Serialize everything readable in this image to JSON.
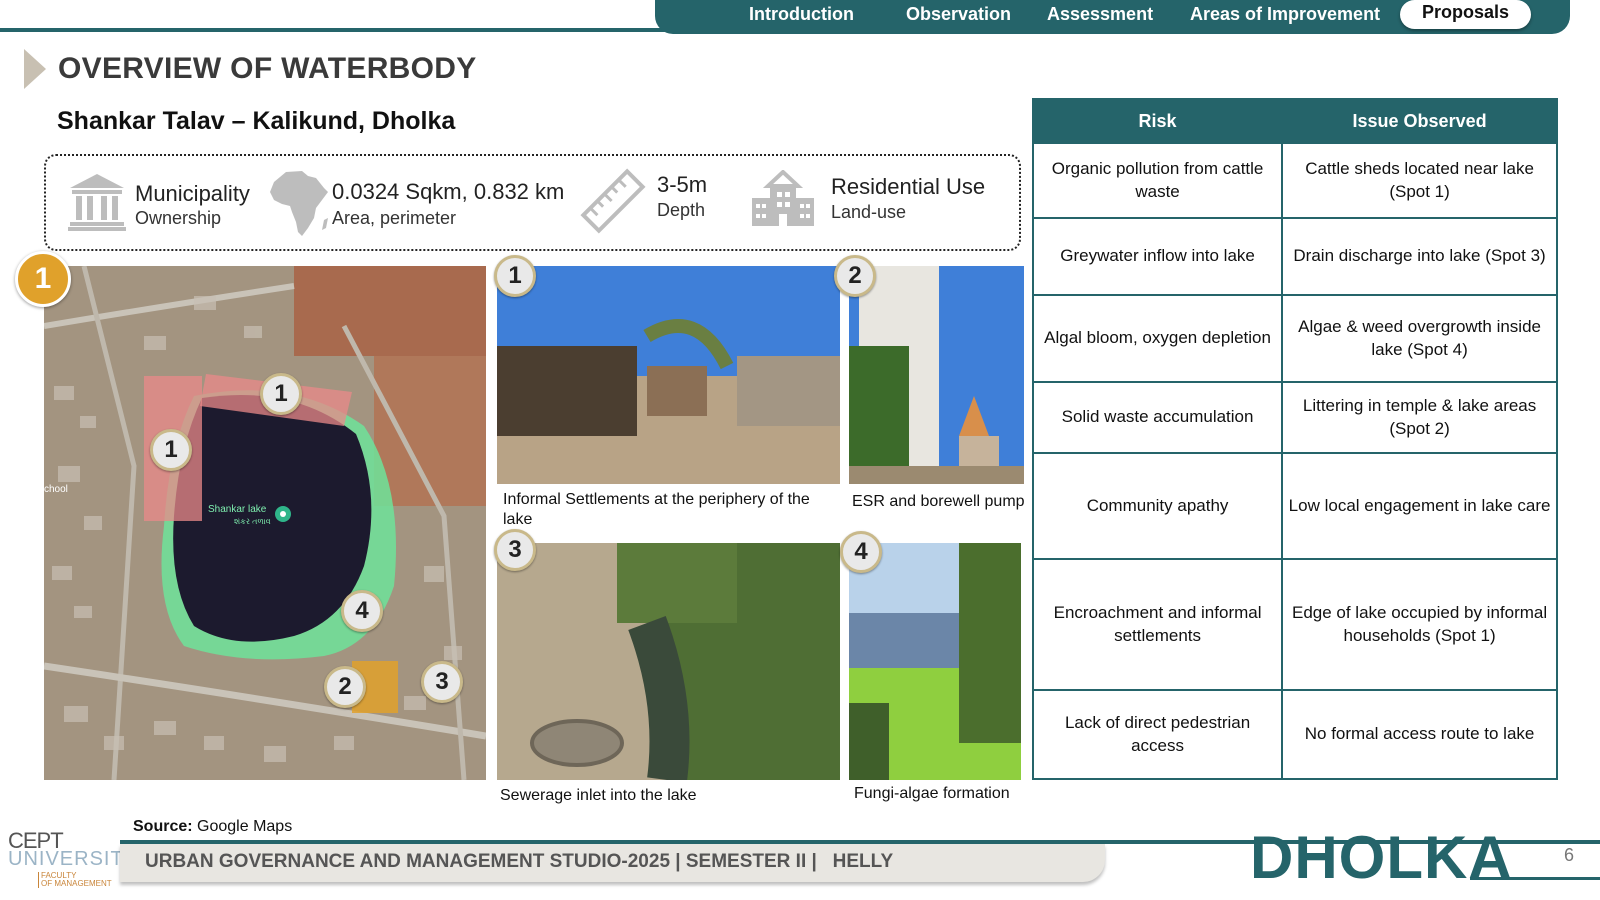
{
  "nav": {
    "items": [
      {
        "label": "Introduction"
      },
      {
        "label": "Observation"
      },
      {
        "label": "Assessment"
      },
      {
        "label": "Areas of Improvement"
      },
      {
        "label": "Proposals"
      }
    ],
    "active": "Proposals"
  },
  "header": {
    "title": "OVERVIEW OF WATERBODY",
    "subtitle": "Shankar Talav – Kalikund, Dholka"
  },
  "stats": [
    {
      "icon": "government-building-icon",
      "value": "Municipality",
      "label": "Ownership"
    },
    {
      "icon": "map-shape-icon",
      "value": "0.0324 Sqkm, 0.832 km",
      "label": "Area, perimeter"
    },
    {
      "icon": "ruler-icon",
      "value": "3-5m",
      "label": "Depth"
    },
    {
      "icon": "residential-buildings-icon",
      "value": "Residential Use",
      "label": "Land-use"
    }
  ],
  "map": {
    "badge": "1",
    "lake_label": "Shankar lake",
    "lake_label_local": "શંકર તળાવ",
    "edge_label": "chool",
    "pins": [
      "1",
      "1",
      "4",
      "2",
      "3"
    ]
  },
  "photos": [
    {
      "number": "1",
      "caption": "Informal Settlements at the periphery of the lake"
    },
    {
      "number": "2",
      "caption": "ESR and borewell pump"
    },
    {
      "number": "3",
      "caption": "Sewerage inlet into the lake"
    },
    {
      "number": "4",
      "caption": "Fungi-algae formation"
    }
  ],
  "table": {
    "headers": [
      "Risk",
      "Issue Observed"
    ],
    "rows": [
      [
        "Organic pollution from cattle waste",
        "Cattle sheds located near lake (Spot 1)"
      ],
      [
        "Greywater inflow into lake",
        "Drain discharge into lake (Spot 3)"
      ],
      [
        "Algal bloom, oxygen depletion",
        "Algae & weed overgrowth inside lake (Spot 4)"
      ],
      [
        "Solid waste accumulation",
        "Littering in temple & lake areas (Spot 2)"
      ],
      [
        "Community apathy",
        "Low local engagement in lake care"
      ],
      [
        "Encroachment and informal settlements",
        "Edge of lake occupied by informal households (Spot 1)"
      ],
      [
        "Lack of direct pedestrian access",
        "No formal access route to lake"
      ]
    ]
  },
  "footer": {
    "source_label": "Source:",
    "source_value": "Google Maps",
    "studio": "URBAN GOVERNANCE AND MANAGEMENT STUDIO-2025 | SEMESTER II |   HELLY",
    "city": "DHOLKA",
    "page": "6",
    "logo_line1": "CEPT",
    "logo_line2": "UNIVERSITY",
    "logo_line3": "FACULTY",
    "logo_line4": "OF MANAGEMENT"
  },
  "colors": {
    "accent": "#25646a",
    "badge": "#e0a12b",
    "title": "#3a3a3a"
  }
}
